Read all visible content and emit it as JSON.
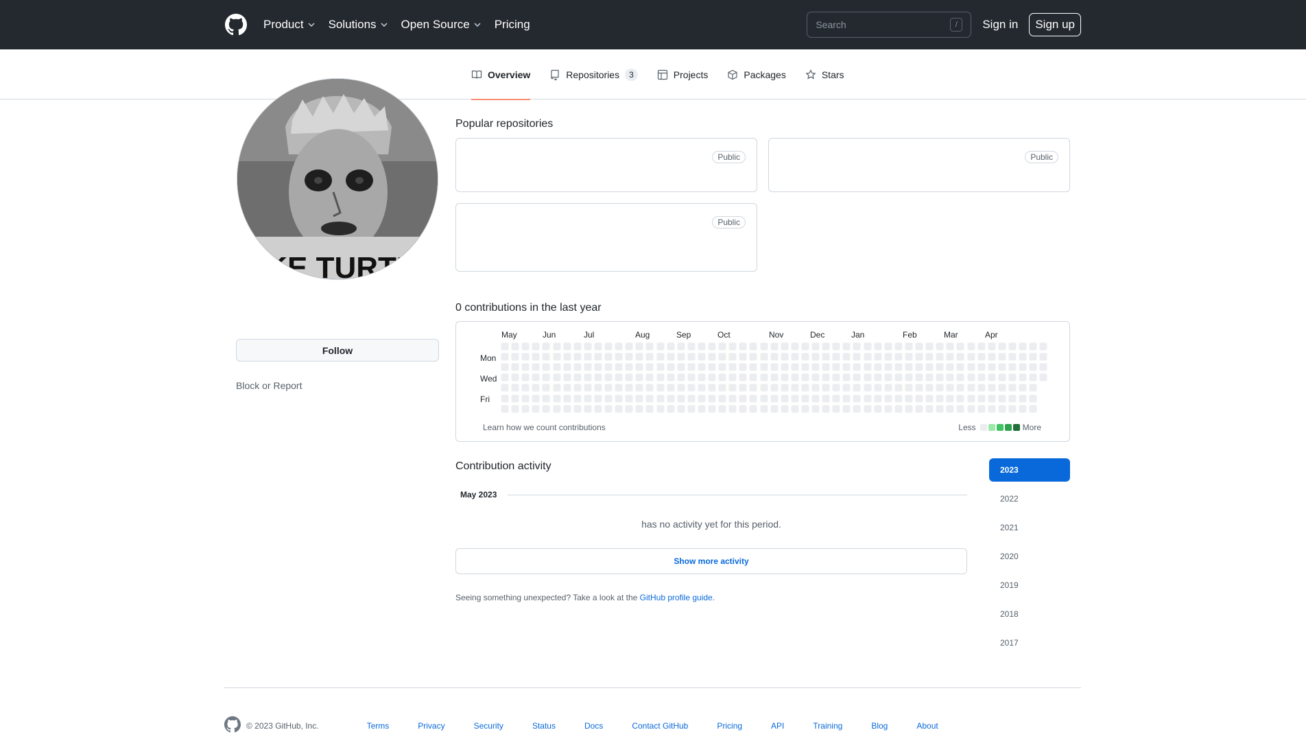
{
  "header": {
    "nav": [
      {
        "label": "Product",
        "has_dropdown": true
      },
      {
        "label": "Solutions",
        "has_dropdown": true
      },
      {
        "label": "Open Source",
        "has_dropdown": true
      },
      {
        "label": "Pricing",
        "has_dropdown": false
      }
    ],
    "search_placeholder": "Search",
    "search_shortcut": "/",
    "sign_in": "Sign in",
    "sign_up": "Sign up"
  },
  "tabs": [
    {
      "label": "Overview",
      "icon": "book-icon",
      "active": true
    },
    {
      "label": "Repositories",
      "icon": "repo-icon",
      "count": "3"
    },
    {
      "label": "Projects",
      "icon": "table-icon"
    },
    {
      "label": "Packages",
      "icon": "package-icon"
    },
    {
      "label": "Stars",
      "icon": "star-icon"
    }
  ],
  "sidebar": {
    "avatar_caption": "KE TURTL",
    "follow_label": "Follow",
    "block_label": "Block or Report"
  },
  "popular": {
    "title": "Popular repositories",
    "repos": [
      {
        "visibility": "Public"
      },
      {
        "visibility": "Public"
      },
      {
        "visibility": "Public"
      }
    ]
  },
  "contributions": {
    "title": "0 contributions in the last year",
    "months": [
      "May",
      "Jun",
      "Jul",
      "Aug",
      "Sep",
      "Oct",
      "Nov",
      "Dec",
      "Jan",
      "Feb",
      "Mar",
      "Apr"
    ],
    "days": [
      "Mon",
      "Wed",
      "Fri"
    ],
    "learn": "Learn how we count contributions",
    "less": "Less",
    "more": "More",
    "legend_colors": [
      "#ebedf0",
      "#9be9a8",
      "#40c463",
      "#30a14e",
      "#216e39"
    ]
  },
  "activity": {
    "title": "Contribution activity",
    "period": "May 2023",
    "no_activity": "has no activity yet for this period.",
    "show_more": "Show more activity",
    "unexpected_prefix": "Seeing something unexpected? Take a look at the",
    "unexpected_link": "GitHub profile guide",
    "unexpected_suffix": "."
  },
  "years": [
    {
      "label": "2023",
      "active": true
    },
    {
      "label": "2022"
    },
    {
      "label": "2021"
    },
    {
      "label": "2020"
    },
    {
      "label": "2019"
    },
    {
      "label": "2018"
    },
    {
      "label": "2017"
    }
  ],
  "footer": {
    "copyright": "© 2023 GitHub, Inc.",
    "links": [
      "Terms",
      "Privacy",
      "Security",
      "Status",
      "Docs",
      "Contact GitHub",
      "Pricing",
      "API",
      "Training",
      "Blog",
      "About"
    ]
  }
}
